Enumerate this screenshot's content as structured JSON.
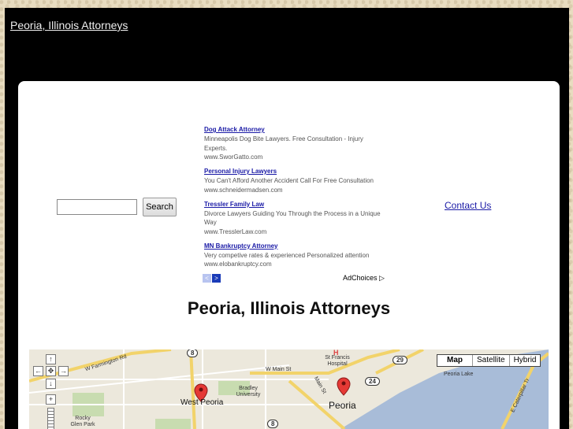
{
  "site": {
    "title": "Peoria, Illinois Attorneys"
  },
  "search": {
    "placeholder": "",
    "button_label": "Search"
  },
  "ads": [
    {
      "title": "Dog Attack Attorney",
      "desc": "Minneapolis Dog Bite Lawyers. Free Consultation - Injury Experts.",
      "url": "www.SworGatto.com"
    },
    {
      "title": "Personal Injury Lawyers",
      "desc": "You Can't Afford Another Accident Call For Free Consultation",
      "url": "www.schneidermadsen.com"
    },
    {
      "title": "Tressler Family Law",
      "desc": "Divorce Lawyers Guiding You Through the Process in a Unique Way",
      "url": "www.TresslerLaw.com"
    },
    {
      "title": "MN Bankruptcy Attorney",
      "desc": "Very competive rates & experienced Personalized attention",
      "url": "www.elobankruptcy.com"
    }
  ],
  "ad_nav": {
    "prev": "<",
    "next": ">",
    "adchoices": "AdChoices ▷"
  },
  "contact": {
    "label": "Contact Us"
  },
  "heading": "Peoria, Illinois Attorneys",
  "map": {
    "types": [
      "Map",
      "Satellite",
      "Hybrid"
    ],
    "labels": {
      "farmington": "W Farmington Rd",
      "main_st": "W Main St",
      "st_francis": "St Francis Hospital",
      "bradley": "Bradley University",
      "peoria_lake": "Peoria Lake",
      "rocky_glen": "Rocky Glen Park",
      "main_st_2": "Main St",
      "caterpillar": "E Caterpillar Tr",
      "west_peoria": "West Peoria",
      "peoria": "Peoria"
    },
    "shields": [
      "8",
      "29",
      "24",
      "8"
    ],
    "controls": {
      "up": "↑",
      "left": "←",
      "center": "✥",
      "right": "→",
      "down": "↓",
      "zoom_in": "+"
    }
  }
}
